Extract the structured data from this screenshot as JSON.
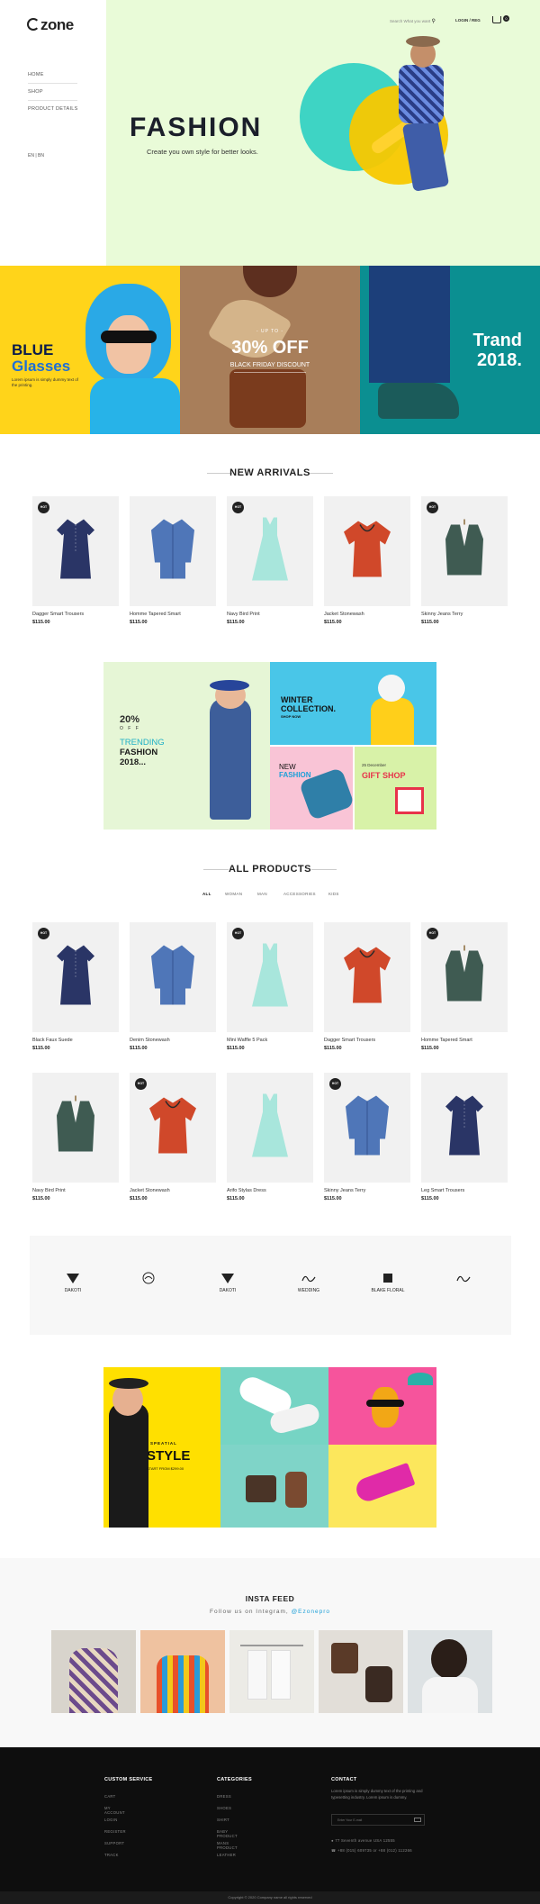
{
  "header": {
    "logo": "zone",
    "search_placeholder": "Search What you want",
    "login": "LOGIN / REG",
    "cart_count": "0"
  },
  "sidebar": {
    "items": [
      {
        "label": "HOME"
      },
      {
        "label": "SHOP"
      },
      {
        "label": "PRODUCT DETAILS"
      }
    ],
    "lang": "EN  |  BN"
  },
  "hero": {
    "title": "FASHION",
    "subtitle": "Create you own style for better looks."
  },
  "banners": {
    "b1_title_a": "BLUE",
    "b1_title_b": "Glasses",
    "b1_text": "Lorem ipsum is simply dummy text of the printing.",
    "b2_upto": "- UP TO -",
    "b2_off": "30% OFF",
    "b2_sub": "BLACK FRIDAY DISCOUNT",
    "b3_title_a": "Trand",
    "b3_title_b": "2018."
  },
  "new_arrivals": {
    "title": "NEW ARRIVALS",
    "products": [
      {
        "name": "Dagger Smart Trousers",
        "price": "$115.00",
        "badge": "HOT",
        "color": "#2a3566",
        "kind": "dress"
      },
      {
        "name": "Homme Tapered Smart",
        "price": "$115.00",
        "badge": "",
        "color": "#4f76b8",
        "kind": "shirt"
      },
      {
        "name": "Navy Bird Print",
        "price": "$115.00",
        "badge": "HOT",
        "color": "#a8e6dc",
        "kind": "sundress"
      },
      {
        "name": "Jacket Stonewash",
        "price": "$115.00",
        "badge": "",
        "color": "#d0482a",
        "kind": "tee"
      },
      {
        "name": "Skinny Jeans Terry",
        "price": "$115.00",
        "badge": "HOT",
        "color": "#3f5b52",
        "kind": "vest"
      }
    ]
  },
  "promo": {
    "p1_pct": "20%",
    "p1_off": "O F F",
    "p1_trending": "TRENDING",
    "p1_fashion": "FASHION",
    "p1_year": "2018...",
    "p2_title_a": "WINTER",
    "p2_title_b": "COLLECTION.",
    "p2_shop": "SHOP NOW",
    "p3_new": "NEW",
    "p3_fashion": "FASHION",
    "p4_sub": "25 December",
    "p4_title": "GIFT SHOP"
  },
  "all_products": {
    "title": "ALL PRODUCTS",
    "tabs": [
      "ALL",
      "WOMAN",
      "MAN",
      "ACCESSORIES",
      "KIDS"
    ],
    "row1": [
      {
        "name": "Black Faux Suede",
        "price": "$115.00",
        "badge": "HOT",
        "color": "#2a3566",
        "kind": "dress"
      },
      {
        "name": "Denim Stonewash",
        "price": "$115.00",
        "badge": "",
        "color": "#4f76b8",
        "kind": "shirt"
      },
      {
        "name": "Mini Waffle 5 Pack",
        "price": "$115.00",
        "badge": "HOT",
        "color": "#a8e6dc",
        "kind": "sundress"
      },
      {
        "name": "Dagger Smart Trousers",
        "price": "$115.00",
        "badge": "",
        "color": "#d0482a",
        "kind": "tee"
      },
      {
        "name": "Homme Tapered Smart",
        "price": "$115.00",
        "badge": "HOT",
        "color": "#3f5b52",
        "kind": "vest"
      }
    ],
    "row2": [
      {
        "name": "Navy Bird Print",
        "price": "$115.00",
        "badge": "",
        "color": "#3f5b52",
        "kind": "vest"
      },
      {
        "name": "Jacket Stonewash",
        "price": "$115.00",
        "badge": "HOT",
        "color": "#d0482a",
        "kind": "tee"
      },
      {
        "name": "Arifo Stylas Dress",
        "price": "$115.00",
        "badge": "",
        "color": "#a8e6dc",
        "kind": "sundress"
      },
      {
        "name": "Skinny Jeans Terry",
        "price": "$115.00",
        "badge": "HOT",
        "color": "#4f76b8",
        "kind": "shirt"
      },
      {
        "name": "Leg Smart Trousers",
        "price": "$115.00",
        "badge": "",
        "color": "#2a3566",
        "kind": "dress"
      }
    ]
  },
  "brands": [
    {
      "label": "DAKOTI",
      "icon": "shield-mark-icon"
    },
    {
      "label": "",
      "icon": "round-seal-icon"
    },
    {
      "label": "DAKOTI",
      "icon": "shield-mark-icon"
    },
    {
      "label": "WEDDING",
      "icon": "script-mark-icon"
    },
    {
      "label": "BLAKE FLORAL",
      "icon": "square-mark-icon"
    },
    {
      "label": "",
      "icon": "script-mark-icon"
    }
  ],
  "style_banner": {
    "tag": "SPEATIAL",
    "title": "STYLE",
    "price": "START FROM $299.00"
  },
  "insta": {
    "title": "INSTA FEED",
    "sub_a": "Follow us on Integram,",
    "handle": "@Ezonepro"
  },
  "footer": {
    "col1": {
      "title": "CUSTOM SERVICE",
      "items": [
        "CART",
        "MY ACCOUNT",
        "LOGIN",
        "REGISTER",
        "SUPPORT",
        "TRACK"
      ]
    },
    "col2": {
      "title": "CATEGORIES",
      "items": [
        "DRESS",
        "SHOES",
        "SHIRT",
        "BABY PRODUCT",
        "MANS PRODUCT",
        "LEATHER"
      ]
    },
    "col3": {
      "title": "CONTACT",
      "text": "Lorem ipsum is simply dummy text of the printing and typesetting industry. Lorem ipsum is dummy.",
      "input_placeholder": "Enter Your E-mail",
      "address": "77 Seventh avenue USA 12555",
      "phone": "+88 (015) 609735 or +88 (012) 112266"
    },
    "copyright": "Copyright © 2020 Company name all rights reserved"
  },
  "colors": {
    "hero_bg": "#e9fbd8",
    "accent_blue": "#1ea0d8",
    "yellow": "#ffd41a",
    "footer_bg": "#0e0e0e"
  }
}
